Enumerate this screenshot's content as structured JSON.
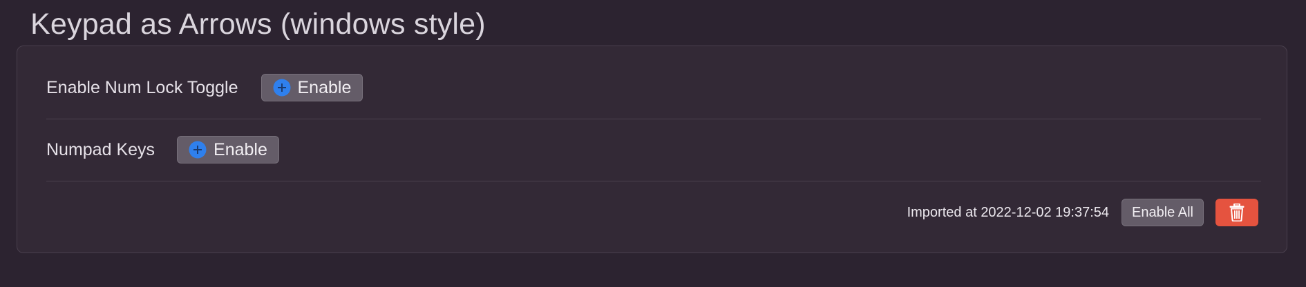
{
  "header": {
    "title": "Keypad as Arrows (windows style)"
  },
  "rules": [
    {
      "label": "Enable Num Lock Toggle",
      "button_label": "Enable",
      "button_icon": "plus-circle-icon"
    },
    {
      "label": "Numpad Keys",
      "button_label": "Enable",
      "button_icon": "plus-circle-icon"
    }
  ],
  "footer": {
    "imported_text": "Imported at 2022-12-02 19:37:54",
    "enable_all_label": "Enable All",
    "delete_icon": "trash-icon"
  },
  "colors": {
    "background": "#2c2330",
    "panel": "#332936",
    "button": "#645c68",
    "accent_blue": "#2f80ed",
    "delete_red": "#e5533f"
  }
}
